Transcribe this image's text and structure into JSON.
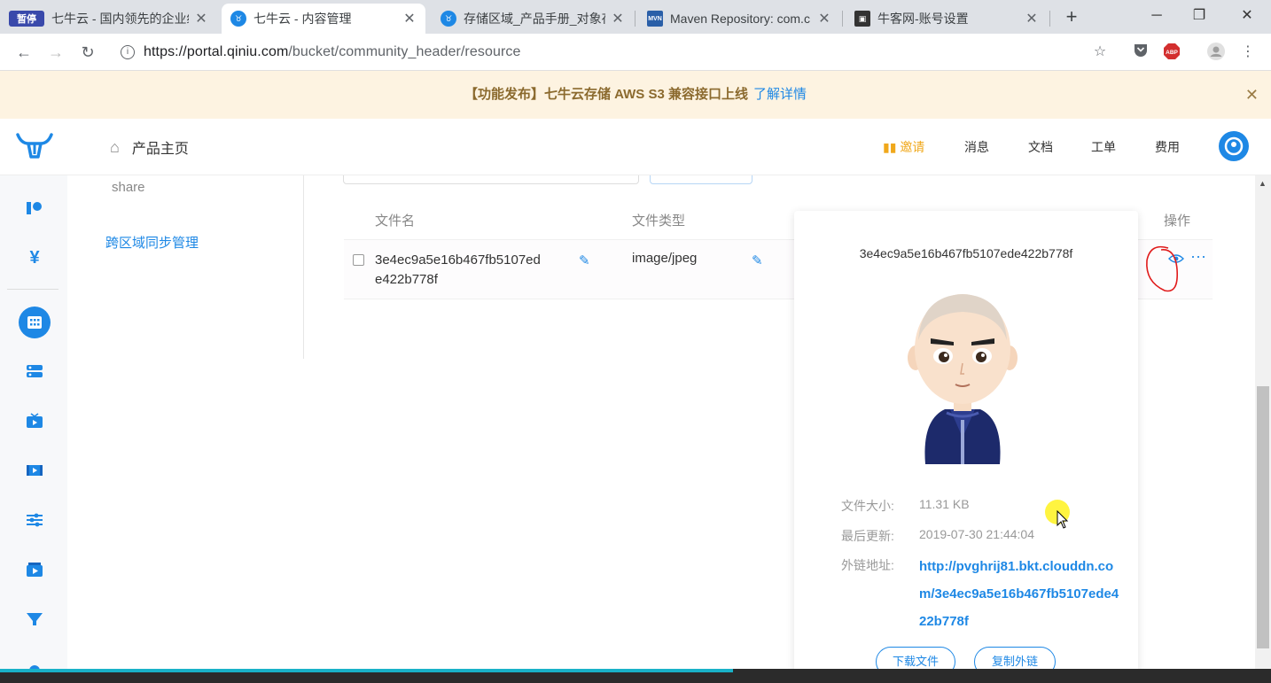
{
  "browser": {
    "tabs": [
      {
        "title": "七牛云 - 国内领先的企业级",
        "favicon": "pause-badge-icon",
        "active": false
      },
      {
        "title": "七牛云 - 内容管理",
        "favicon": "qiniu-icon",
        "active": true
      },
      {
        "title": "存储区域_产品手册_对象存",
        "favicon": "qiniu-icon",
        "active": false
      },
      {
        "title": "Maven Repository: com.c",
        "favicon": "mvn-icon",
        "active": false
      },
      {
        "title": "牛客网-账号设置",
        "favicon": "nowcoder-icon",
        "active": false
      }
    ],
    "favicon_pause_label": "暂停",
    "favicon_mvn_label": "MVN",
    "url_host": "https://portal.qiniu.com",
    "url_path": "/bucket/community_header/resource",
    "abp_label": "ABP"
  },
  "notice": {
    "text": "【功能发布】七牛云存储 AWS S3 兼容接口上线",
    "link": "了解详情"
  },
  "header": {
    "home_label": "产品主页",
    "nav": {
      "invite": "邀请",
      "messages": "消息",
      "docs": "文档",
      "ticket": "工单",
      "billing": "费用"
    }
  },
  "subnav": {
    "item_share": "share",
    "item_sync": "跨区域同步管理"
  },
  "table": {
    "columns": {
      "name": "文件名",
      "type": "文件类型",
      "ops": "操作"
    },
    "rows": [
      {
        "name": "3e4ec9a5e16b467fb5107ede422b778f",
        "type": "image/jpeg"
      }
    ]
  },
  "preview": {
    "key": "3e4ec9a5e16b467fb5107ede422b778f",
    "size_label": "文件大小:",
    "size_value": "11.31 KB",
    "updated_label": "最后更新:",
    "updated_value": "2019-07-30 21:44:04",
    "link_label": "外链地址:",
    "link_value": "http://pvghrij81.bkt.clouddn.com/3e4ec9a5e16b467fb5107ede422b778f",
    "download_button": "下载文件",
    "copy_button": "复制外链"
  },
  "colors": {
    "accent": "#1e88e5",
    "notice_bg": "#fdf3e1",
    "invite": "#f0a81b"
  },
  "video_progress": 0.577
}
